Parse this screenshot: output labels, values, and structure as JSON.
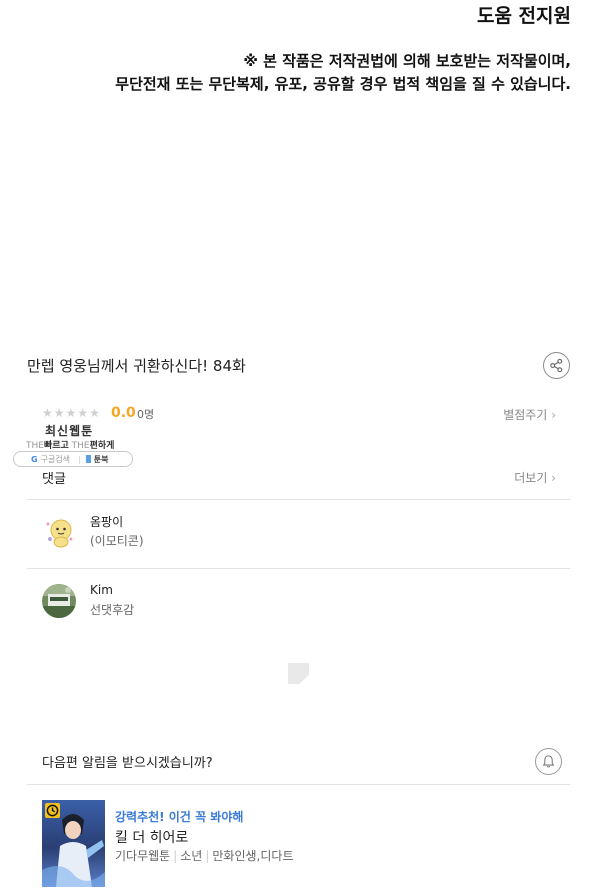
{
  "credits": {
    "assistant_line": "도움 전지원",
    "copyright_line1": "※ 본 작품은 저작권법에 의해 보호받는 저작물이며,",
    "copyright_line2": "무단전재 또는 무단복제, 유포, 공유할 경우 법적 책임을 질 수 있습니다."
  },
  "episode": {
    "title": "만렙 영웅님께서 귀환하신다! 84화",
    "share_icon": "share-icon"
  },
  "rating": {
    "stars_total": 5,
    "stars_filled": 0,
    "score": "0.0",
    "count": "0명",
    "rate_link": "별점주기"
  },
  "badge": {
    "title": "최신웹툰",
    "the1": "THE",
    "fast": "빠르고",
    "the2": "THE",
    "easy": "편하게",
    "google_g": "G",
    "google_text": "구글검색",
    "site": "툰북"
  },
  "comments": {
    "label": "댓글",
    "more_link": "더보기",
    "items": [
      {
        "name": "옴팡이",
        "text": "(이모티콘)"
      },
      {
        "name": "Kim",
        "text": "선댓후감"
      }
    ]
  },
  "notify": {
    "question": "다음편 알림을 받으시겠습니까?",
    "icon": "bell-icon"
  },
  "recommend": {
    "tag": "강력추천! 이건 꼭 봐야해",
    "title": "킬 더 히어로",
    "meta": [
      "기다무웹툰",
      "소년",
      "만화인생,디다트"
    ]
  },
  "colors": {
    "score": "#f5a623",
    "link": "#3a7bd5",
    "divider": "#e3e3e3"
  }
}
